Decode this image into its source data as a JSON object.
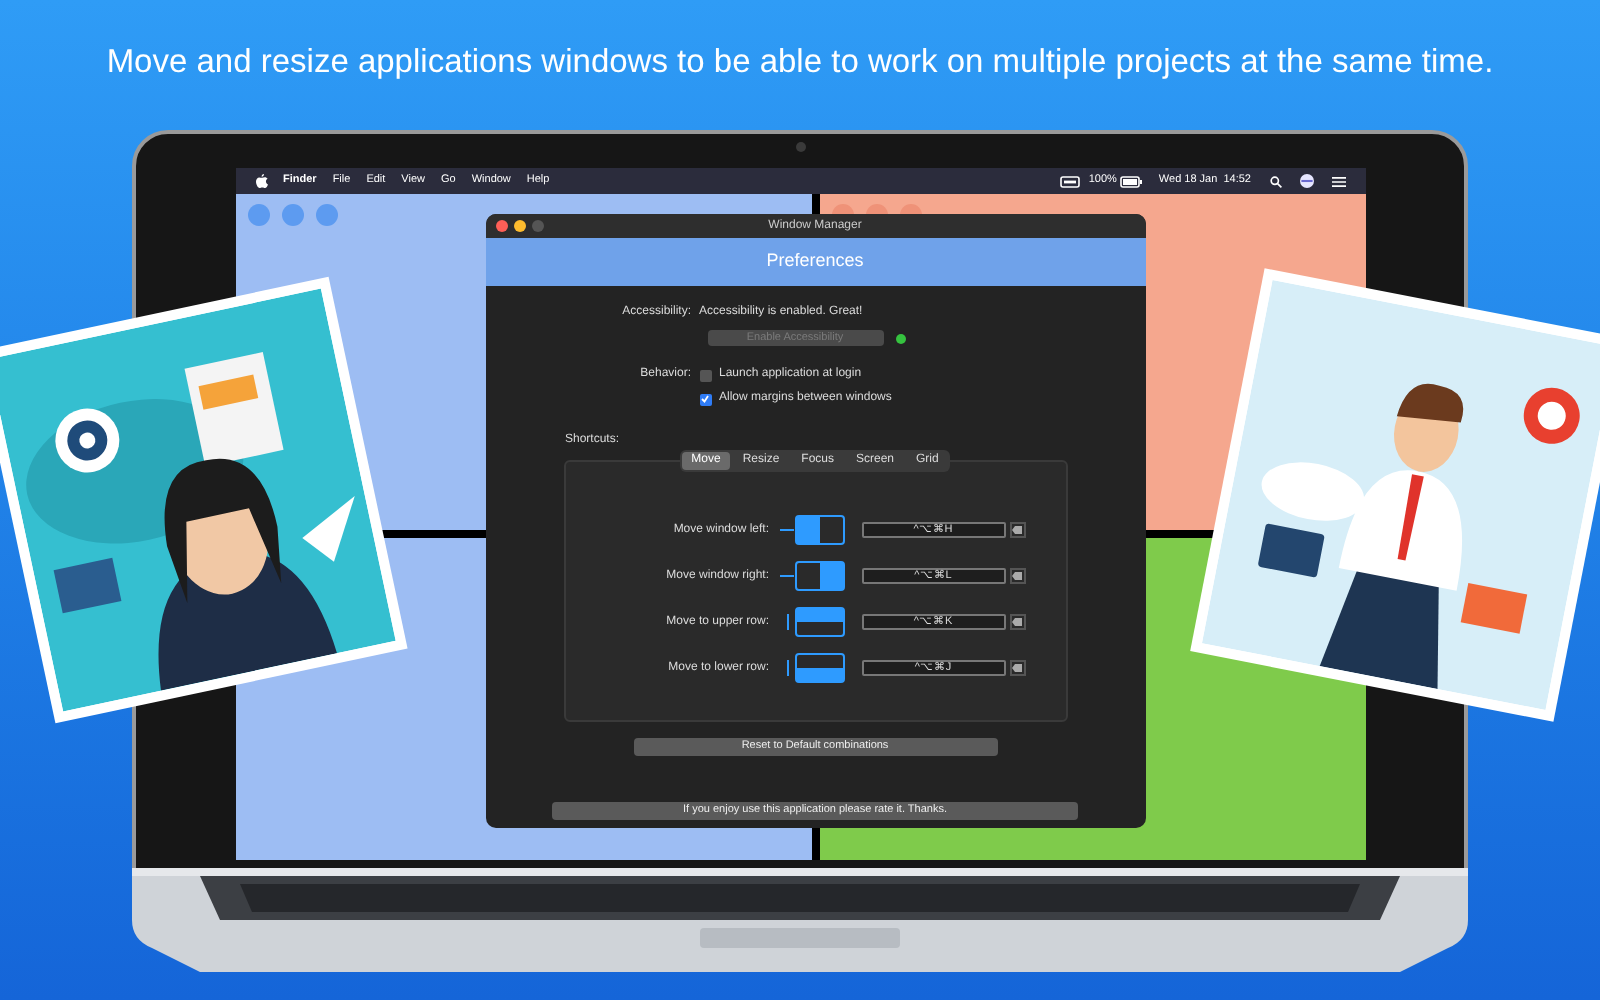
{
  "headline": "Move and resize applications windows to be able to work on multiple projects at the same time.",
  "menu_bar": {
    "items": [
      "Finder",
      "File",
      "Edit",
      "View",
      "Go",
      "Window",
      "Help"
    ],
    "battery": "100%",
    "clock": "Wed 18 Jan  14:52"
  },
  "desktop": {
    "tiles": [
      {
        "color": "#9dbdf3"
      },
      {
        "color": "#f5a78e"
      },
      {
        "color": "#9dbdf3"
      },
      {
        "color": "#7fcb4b"
      }
    ]
  },
  "window": {
    "title": "Window Manager",
    "header": "Preferences",
    "accessibility": {
      "label": "Accessibility:",
      "status": "Accessibility is enabled. Great!",
      "button": {
        "label": "Enable Accessibility",
        "disabled": true
      },
      "enabled": true
    },
    "behavior": {
      "label": "Behavior:",
      "options": [
        {
          "label": "Launch application at login",
          "checked": false
        },
        {
          "label": "Allow margins between windows",
          "checked": true
        }
      ]
    },
    "shortcuts": {
      "label": "Shortcuts:",
      "tabs": [
        {
          "label": "Move",
          "selected": true
        },
        {
          "label": "Resize",
          "selected": false
        },
        {
          "label": "Focus",
          "selected": false
        },
        {
          "label": "Screen",
          "selected": false
        },
        {
          "label": "Grid",
          "selected": false
        }
      ],
      "rows": [
        {
          "label": "Move window left:",
          "kind": "left",
          "shortcut": "^⌥⌘H"
        },
        {
          "label": "Move window right:",
          "kind": "right",
          "shortcut": "^⌥⌘L"
        },
        {
          "label": "Move to upper row:",
          "kind": "top",
          "shortcut": "^⌥⌘K"
        },
        {
          "label": "Move to lower row:",
          "kind": "bottom",
          "shortcut": "^⌥⌘J"
        }
      ]
    },
    "reset_button": "Reset to Default combinations",
    "rate_message": "If you enjoy use this application please rate it. Thanks."
  }
}
